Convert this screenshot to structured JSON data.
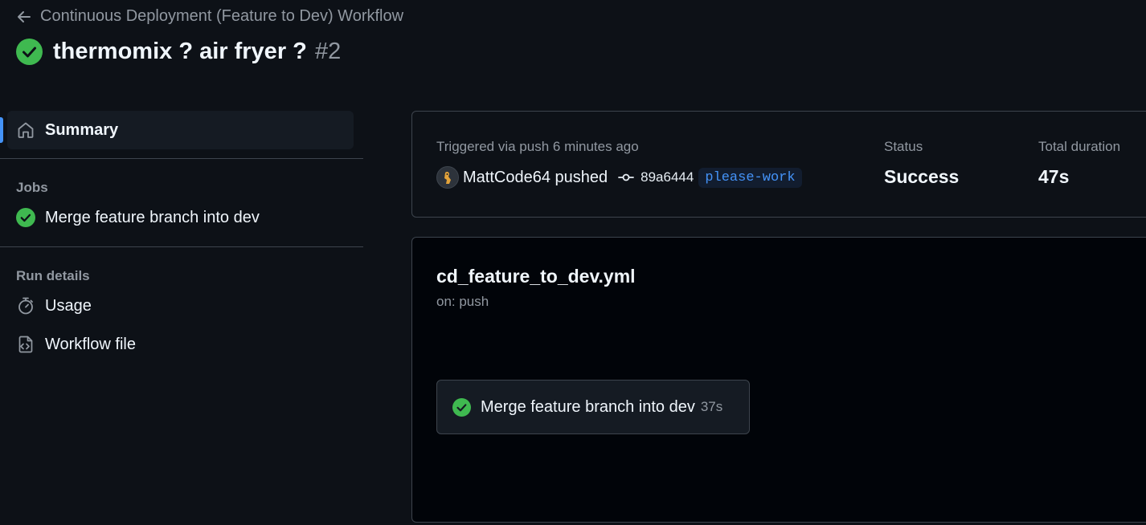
{
  "header": {
    "back_label": "Continuous Deployment (Feature to Dev) Workflow",
    "run_title": "thermomix ? air fryer ?",
    "run_number": "#2",
    "status_color": "#3fb950"
  },
  "sidebar": {
    "summary_label": "Summary",
    "jobs_title": "Jobs",
    "jobs": [
      {
        "label": "Merge feature branch into dev",
        "status": "success"
      }
    ],
    "run_details_title": "Run details",
    "run_details": [
      {
        "label": "Usage",
        "icon": "stopwatch-icon"
      },
      {
        "label": "Workflow file",
        "icon": "file-code-icon"
      }
    ]
  },
  "trigger": {
    "text": "Triggered via push 6 minutes ago",
    "actor_text": "MattCode64 pushed",
    "commit_sha": "89a6444",
    "branch": "please-work",
    "status_label": "Status",
    "status_value": "Success",
    "duration_label": "Total duration",
    "duration_value": "47s"
  },
  "workflow": {
    "file_name": "cd_feature_to_dev.yml",
    "on_text": "on: push",
    "job": {
      "name": "Merge feature branch into dev",
      "duration": "37s"
    }
  },
  "colors": {
    "accent": "#4493f8",
    "success": "#3fb950",
    "background": "#0d1117"
  }
}
